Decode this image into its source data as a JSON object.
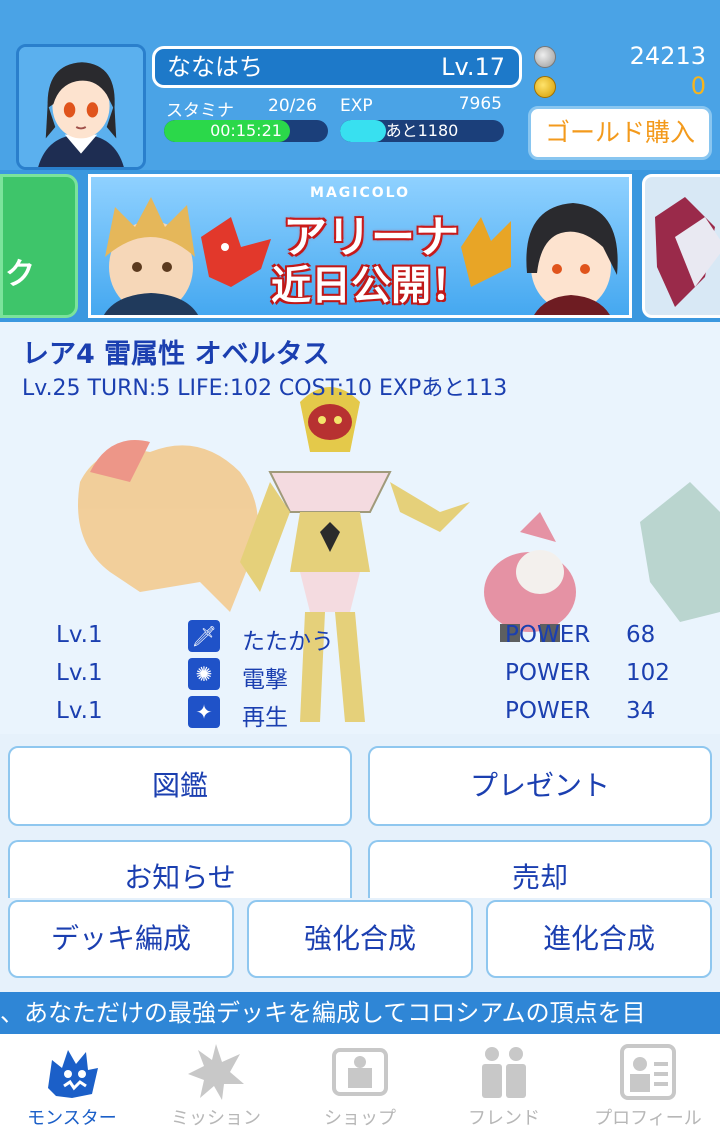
{
  "header": {
    "player_name": "ななはち",
    "level": "Lv.17",
    "stamina_label": "スタミナ",
    "stamina_value": "20/26",
    "stamina_timer": "00:15:21",
    "stamina_fraction": 0.77,
    "exp_label": "EXP",
    "exp_value": "7965",
    "exp_remaining": "あと1180",
    "exp_fraction": 0.28,
    "silver_count": "24213",
    "gold_count": "0",
    "gold_button_label": "ゴールド購入"
  },
  "banner": {
    "brand": "MAGICOLO",
    "line1": "アリーナ",
    "line2": "近日公開！"
  },
  "monster": {
    "title": "レア4 雷属性 オベルタス",
    "stats": "Lv.25 TURN:5 LIFE:102 COST:10 EXPあと113",
    "skills": [
      {
        "level": "Lv.1",
        "icon": "sword-icon",
        "name": "たたかう",
        "power_label": "POWER",
        "power": "68"
      },
      {
        "level": "Lv.1",
        "icon": "lightning-gear-icon",
        "name": "電撃",
        "power_label": "POWER",
        "power": "102"
      },
      {
        "level": "Lv.1",
        "icon": "sparkle-icon",
        "name": "再生",
        "power_label": "POWER",
        "power": "34"
      }
    ]
  },
  "menu": {
    "zukan": "図鑑",
    "present": "プレゼント",
    "news": "お知らせ",
    "sell": "売却",
    "deck": "デッキ編成",
    "enhance": "強化合成",
    "evolve": "進化合成"
  },
  "ticker": "、あなただけの最強デッキを編成してコロシアムの頂点を目",
  "nav": {
    "monster": "モンスター",
    "mission": "ミッション",
    "shop": "ショップ",
    "friend": "フレンド",
    "profile": "プロフィール"
  },
  "colors": {
    "header_bg": "#4aa3e6",
    "accent_text": "#1b3fb0",
    "gold": "#f39a1c",
    "stamina_bar": "#2bd84a",
    "exp_bar": "#38e0f0"
  }
}
